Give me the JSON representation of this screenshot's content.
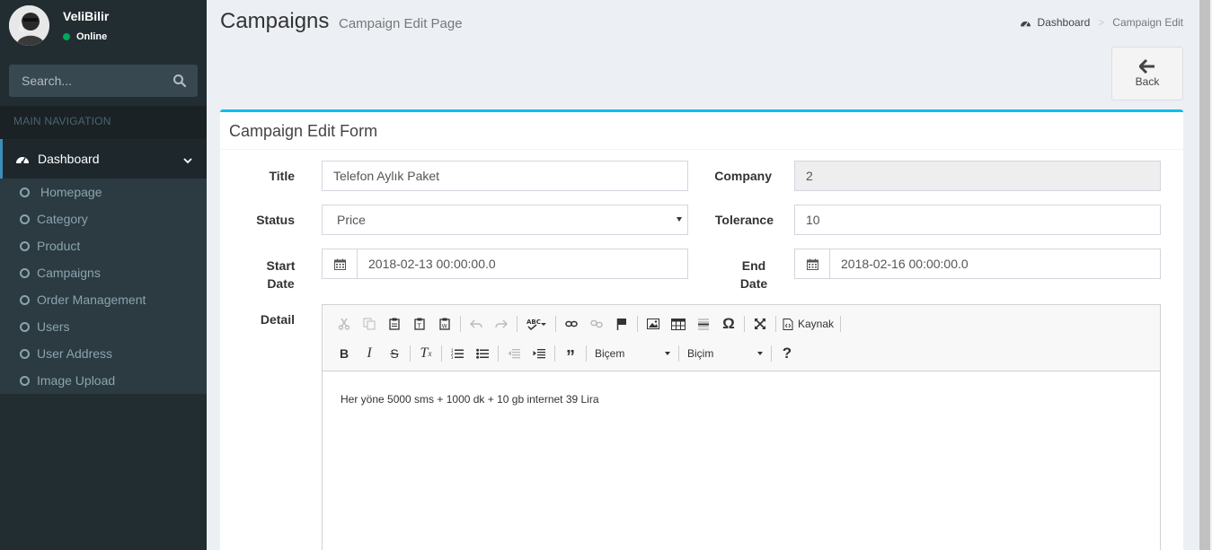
{
  "user": {
    "name": "VeliBilir",
    "status": "Online"
  },
  "search": {
    "placeholder": "Search..."
  },
  "nav": {
    "header": "MAIN NAVIGATION",
    "dashboard": "Dashboard",
    "items": [
      "Homepage",
      "Category",
      "Product",
      "Campaigns",
      "Order Management",
      "Users",
      "User Address",
      "Image Upload"
    ]
  },
  "page": {
    "title": "Campaigns",
    "subtitle": "Campaign Edit Page"
  },
  "breadcrumb": {
    "home": "Dashboard",
    "current": "Campaign Edit"
  },
  "back_label": "Back",
  "form": {
    "title": "Campaign Edit Form",
    "labels": {
      "title": "Title",
      "company": "Company",
      "status": "Status",
      "tolerance": "Tolerance",
      "start_date_1": "Start",
      "start_date_2": "Date",
      "end_date_1": "End",
      "end_date_2": "Date",
      "detail": "Detail"
    },
    "values": {
      "title": "Telefon Aylık Paket",
      "company": "2",
      "status": "Price",
      "tolerance": "10",
      "start_date": "2018-02-13 00:00:00.0",
      "end_date": "2018-02-16 00:00:00.0"
    }
  },
  "editor": {
    "source_label": "Kaynak",
    "styles_label": "Biçem",
    "format_label": "Biçim",
    "help_label": "?",
    "content": "Her yöne 5000 sms + 1000 dk + 10 gb internet 39 Lira"
  },
  "colors": {
    "sidebar": "#222d32",
    "accent": "#3c8dbc",
    "box_top": "#00c0ef",
    "online": "#00a65a"
  }
}
